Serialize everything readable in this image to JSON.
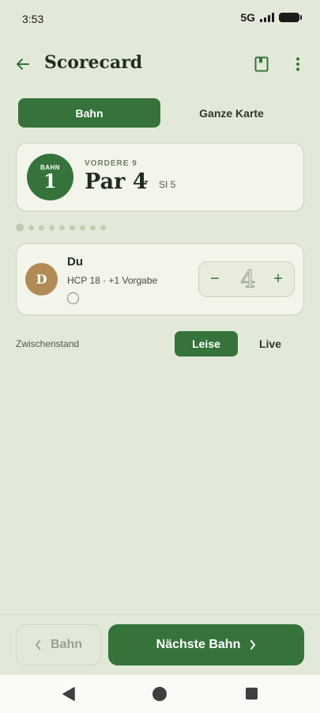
{
  "status": {
    "time": "3:53",
    "network": "5G"
  },
  "appbar": {
    "title": "Scorecard",
    "back_icon": "arrow-left-icon",
    "book_icon": "bookmark-book-icon",
    "more_icon": "more-vert-icon"
  },
  "tabs": {
    "hole": "Bahn",
    "full": "Ganze Karte"
  },
  "hole": {
    "label": "BAHN",
    "number": "1",
    "section": "VORDERE 9",
    "par": "Par 4",
    "si": "SI 5"
  },
  "pager": {
    "count": 9,
    "active_index": 0
  },
  "player": {
    "initial": "D",
    "name": "Du",
    "handicap": "HCP 18 · +1 Vorgabe",
    "score": "4",
    "minus": "−",
    "plus": "+"
  },
  "standing": {
    "label": "Zwischenstand",
    "quiet": "Leise",
    "live": "Live"
  },
  "footer": {
    "prev_label": "Bahn",
    "next_label": "Nächste Bahn",
    "prev_icon": "chevron-left-icon",
    "next_icon": "chevron-right-icon"
  },
  "colors": {
    "accent": "#35733b",
    "background": "#e3e9d8",
    "card": "#f3f5ea",
    "avatar": "#b18a55"
  }
}
